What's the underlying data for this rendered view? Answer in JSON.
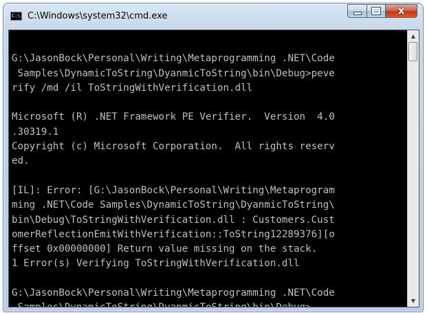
{
  "window": {
    "title": "C:\\Windows\\system32\\cmd.exe",
    "icon": "cmd-icon",
    "icon_text": "C:\\",
    "close_label": "x"
  },
  "console": {
    "lines": [
      "",
      "G:\\JasonBock\\Personal\\Writing\\Metaprogramming .NET\\Code",
      " Samples\\DynamicToString\\DyanmicToString\\bin\\Debug>peve",
      "rify /md /il ToStringWithVerification.dll",
      "",
      "Microsoft (R) .NET Framework PE Verifier.  Version  4.0",
      ".30319.1",
      "Copyright (c) Microsoft Corporation.  All rights reserv",
      "ed.",
      "",
      "[IL]: Error: [G:\\JasonBock\\Personal\\Writing\\Metaprogram",
      "ming .NET\\Code Samples\\DynamicToString\\DyanmicToString\\",
      "bin\\Debug\\ToStringWithVerification.dll : Customers.Cust",
      "omerReflectionEmitWithVerification::ToString12289376][o",
      "ffset 0x00000000] Return value missing on the stack.",
      "1 Error(s) Verifying ToStringWithVerification.dll",
      "",
      "G:\\JasonBock\\Personal\\Writing\\Metaprogramming .NET\\Code",
      " Samples\\DynamicToString\\DyanmicToString\\bin\\Debug>"
    ]
  },
  "scrollbar": {
    "up_glyph": "▲",
    "down_glyph": "▼"
  }
}
